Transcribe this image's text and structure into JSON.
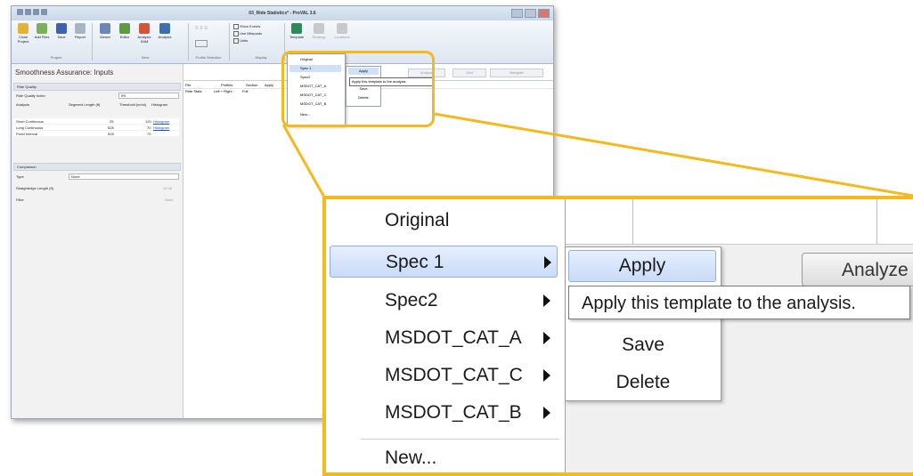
{
  "window": {
    "title": "03_Ride Statistics* - ProVAL 3.6"
  },
  "ribbon": {
    "buttons": [
      {
        "label": "Close Project"
      },
      {
        "label": "Add Files"
      },
      {
        "label": "Save"
      },
      {
        "label": "Report"
      },
      {
        "label": "Viewer"
      },
      {
        "label": "Editor"
      },
      {
        "label": "Analysis SAM"
      },
      {
        "label": "Analysis"
      },
      {
        "label": "Template"
      },
      {
        "label": "Strategy"
      },
      {
        "label": "Locations"
      }
    ],
    "groups": [
      "Project",
      "View",
      "Profile Selection",
      "Display"
    ],
    "display_options": [
      "Show Events",
      "Use Mileposts",
      "Units"
    ]
  },
  "left_panel": {
    "title": "Smoothness Assurance: Inputs",
    "ride_quality_section": "Ride Quality",
    "ride_quality_index_label": "Ride Quality Index",
    "ride_quality_index_value": "IRI",
    "table_headers": [
      "Analysis",
      "Segment Length (ft)",
      "Threshold (in/mi)",
      "Histogram"
    ],
    "rows": [
      {
        "analysis": "Short Continuous",
        "segment": "25",
        "threshold": "120",
        "histogram": "Histogram"
      },
      {
        "analysis": "Long Continuous",
        "segment": "528",
        "threshold": "70",
        "histogram": "Histogram"
      },
      {
        "analysis": "Fixed Interval",
        "segment": "528",
        "threshold": "70",
        "histogram": ""
      }
    ],
    "comparison_section": "Comparison",
    "type_label": "Type",
    "type_value": "None",
    "straightedge_label": "Straightedge Length (ft)",
    "straightedge_value": "10.00",
    "filter_label": "Filter",
    "filter_value": "None"
  },
  "main": {
    "file_headers": [
      "File",
      "Profiles",
      "Section",
      "Apply"
    ],
    "file_row": [
      "Ride Stats",
      "Left + Right",
      "Full"
    ],
    "buttons": [
      "Analyze",
      "Grid",
      "Navigate"
    ]
  },
  "template_menu": {
    "items": [
      {
        "label": "Original",
        "has_submenu": false
      },
      {
        "label": "Spec 1",
        "has_submenu": true
      },
      {
        "label": "Spec2",
        "has_submenu": true
      },
      {
        "label": "MSDOT_CAT_A",
        "has_submenu": true
      },
      {
        "label": "MSDOT_CAT_C",
        "has_submenu": true
      },
      {
        "label": "MSDOT_CAT_B",
        "has_submenu": true
      },
      {
        "label": "New...",
        "has_submenu": false
      }
    ],
    "submenu": [
      "Apply",
      "Save",
      "Delete"
    ],
    "tooltip": "Apply this template to the analysis.",
    "analyze_button": "Analyze"
  },
  "colors": {
    "highlight_border": "#f3b91e",
    "menu_hover": "#c9dbf7",
    "link": "#1a4fd0"
  }
}
